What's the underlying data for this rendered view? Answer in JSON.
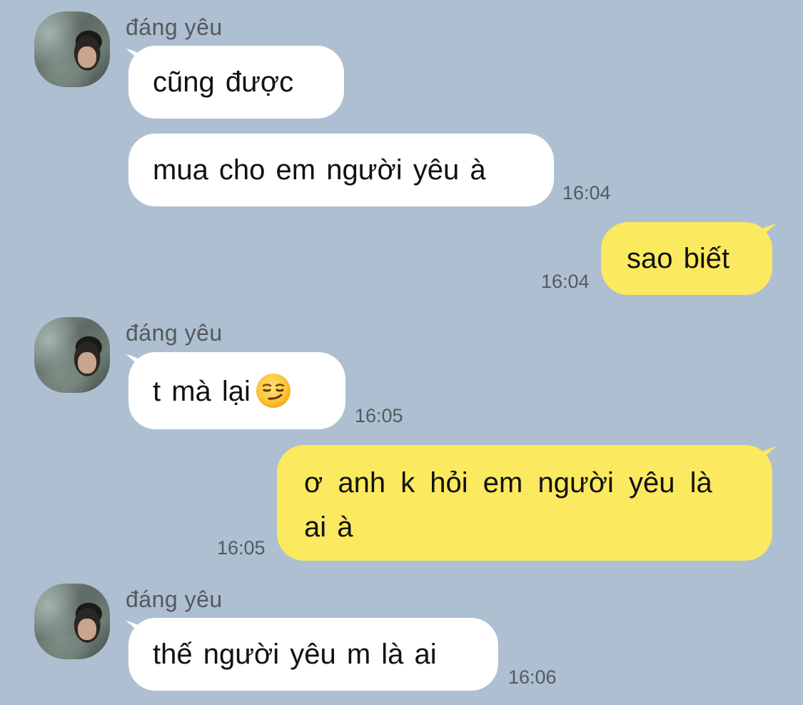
{
  "messages": [
    {
      "side": "in",
      "sender": "đáng yêu",
      "text": "cũng được",
      "time": ""
    },
    {
      "side": "in",
      "sender": "",
      "text": "mua cho em người yêu à",
      "time": "16:04"
    },
    {
      "side": "out",
      "text": "sao biết",
      "time": "16:04"
    },
    {
      "side": "in",
      "sender": "đáng yêu",
      "text": "t mà lại",
      "emoji": "smirking-face-icon",
      "time": "16:05"
    },
    {
      "side": "out",
      "text_line1": "ơ anh k hỏi em người yêu là",
      "text_line2": "ai à",
      "time": "16:05"
    },
    {
      "side": "in",
      "sender": "đáng yêu",
      "text": "thế người yêu m là ai",
      "time": "16:06"
    }
  ],
  "colors": {
    "background": "#adbfd0",
    "incoming_bubble": "#ffffff",
    "outgoing_bubble": "#fbe95f",
    "meta_text": "#54595f"
  }
}
